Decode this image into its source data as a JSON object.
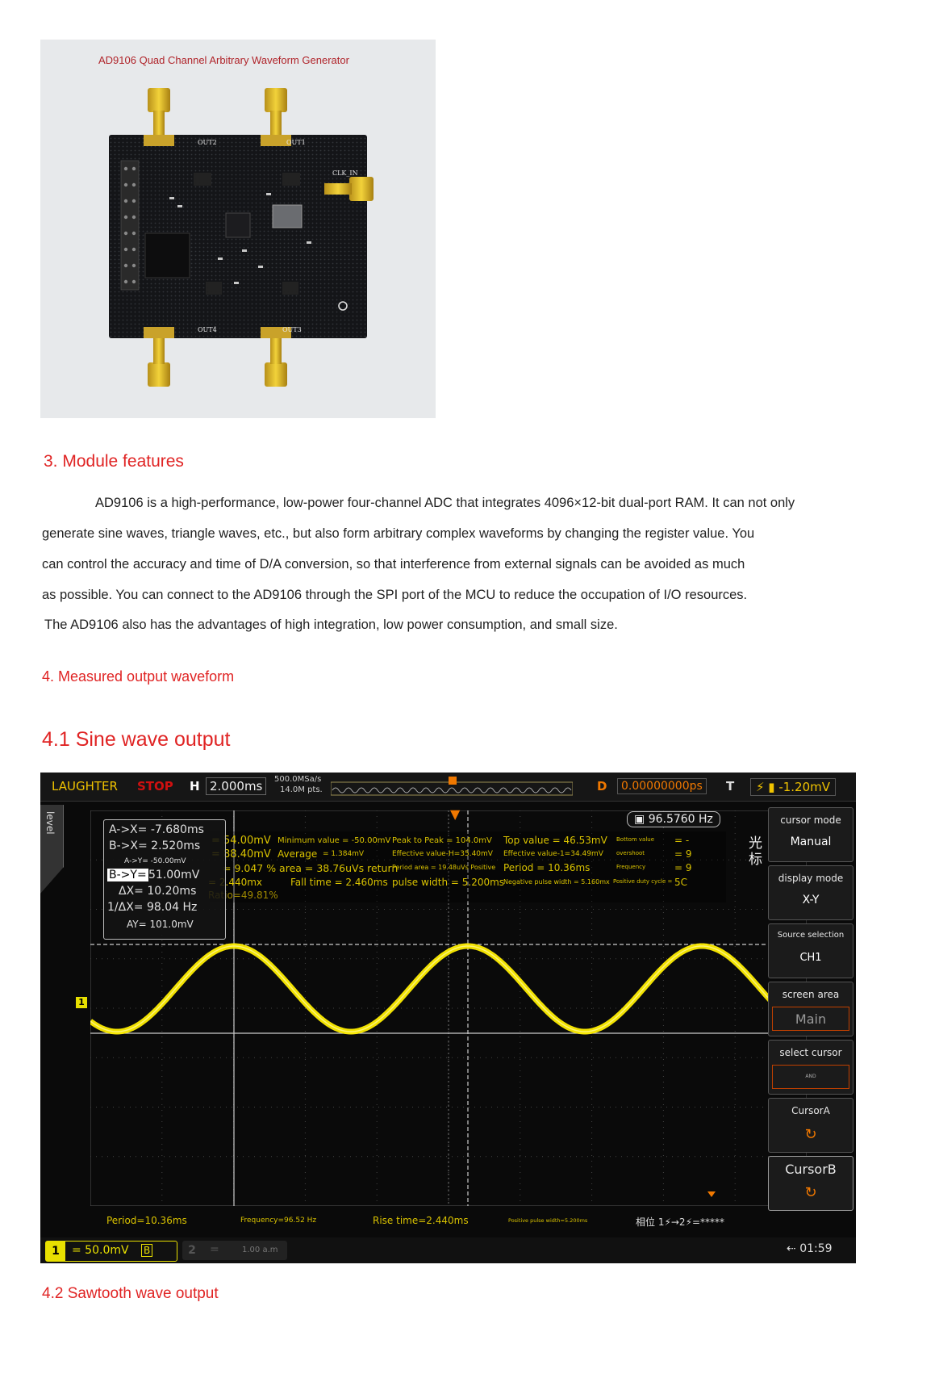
{
  "board": {
    "caption": "AD9106 Quad Channel Arbitrary Waveform Generator",
    "labels": [
      "OUT2",
      "OUT1",
      "CLK_IN",
      "OUT4",
      "OUT3"
    ]
  },
  "section3": {
    "heading": "3. Module features",
    "lines": [
      "AD9106 is a high-performance, low-power four-channel ADC that integrates 4096×12-bit dual-port RAM. It can not only",
      "generate sine waves, triangle waves, etc., but also form arbitrary complex waveforms by changing the register value. You",
      "can control the accuracy and time of D/A conversion, so that interference from external signals can be avoided as much",
      "as possible. You can connect to the AD9106 through the SPI port of the MCU to reduce the occupation of I/O resources.",
      "The AD9106 also has the advantages of high integration, low power consumption, and small size."
    ]
  },
  "section4": {
    "heading": "4. Measured output waveform"
  },
  "section41": {
    "heading": "4.1 Sine wave output"
  },
  "section42": {
    "heading": "4.2 Sawtooth wave output"
  },
  "scope": {
    "title": "LAUGHTER",
    "stop": "STOP",
    "h_label": "H",
    "timebase": "2.000ms",
    "sample_rate": "500.0MSa/s",
    "points": "14.0M pts.",
    "d_label": "D",
    "delay": "0.00000000ps",
    "t_label": "T",
    "trigger_level": "-1.20mV",
    "level_tab": "level",
    "frequency_badge": "96.5760 Hz",
    "cursor": {
      "ax": "A->X= -7.680ms",
      "bx": "B->X= 2.520ms",
      "ay": "A->Y= -50.00mV",
      "by_label": "B->Y=",
      "by_value": "51.00mV",
      "dx": "ΔX= 10.20ms",
      "inv_dx": "1/ΔX= 98.04 Hz",
      "dy": "AY= 101.0mV"
    },
    "measurements": {
      "r1": [
        "= 54.00mV",
        "Minimum value = -50.00mV",
        "Peak to Peak = 104.0mV",
        "Top value = 46.53mV",
        "Bottom value",
        "= -"
      ],
      "r2": [
        "= 88.40mV",
        "Average",
        "= 1.384mV",
        "Effective value-H=35.40mV",
        "Effective value-1=34.49mV",
        "overshoot",
        "= 9"
      ],
      "r3": [
        "= 9.047 % area = 38.76uVs return",
        "Period area = 19.48uVs Positive",
        "Period = 10.36ms",
        "Frequency",
        "= 9"
      ],
      "r4": [
        "= 2.440mx",
        "Fall time = 2.460ms",
        "pulse width = 5.200ms",
        "Negative pulse width = 5.160mx",
        "Positive duty cycle =",
        "5C"
      ],
      "r5": [
        "Ratio=49.81%"
      ]
    },
    "side_chars": [
      "光",
      "标"
    ],
    "side_menu": [
      {
        "title": "cursor mode",
        "value": "Manual"
      },
      {
        "title": "display mode",
        "value": "X-Y"
      },
      {
        "title": "Source selection",
        "value": "CH1"
      },
      {
        "title": "screen area",
        "value": "Main"
      },
      {
        "title": "select cursor",
        "value": "AND"
      },
      {
        "title": "CursorA",
        "value": "↻"
      },
      {
        "title": "CursorB",
        "value": "↻"
      }
    ],
    "bottom_measure": {
      "period": "Period=10.36ms",
      "frequency": "Frequency=96.52 Hz",
      "rise": "Rise time=2.440ms",
      "pos_pulse": "Positive pulse width=5.200ms",
      "phase": "相位 1⚡→2⚡=*****"
    },
    "channel1": {
      "num": "1",
      "scale": "= 50.0mV",
      "tag": "B"
    },
    "channel2": {
      "num": "2",
      "scale": "=",
      "extra": "1.00 a.m"
    },
    "clock": "01:59",
    "ch_marker": "1",
    "colors": {
      "trace": "#ffee00",
      "text": "#d9c200",
      "bg": "#0a0a0a",
      "stop": "#d01010"
    }
  }
}
